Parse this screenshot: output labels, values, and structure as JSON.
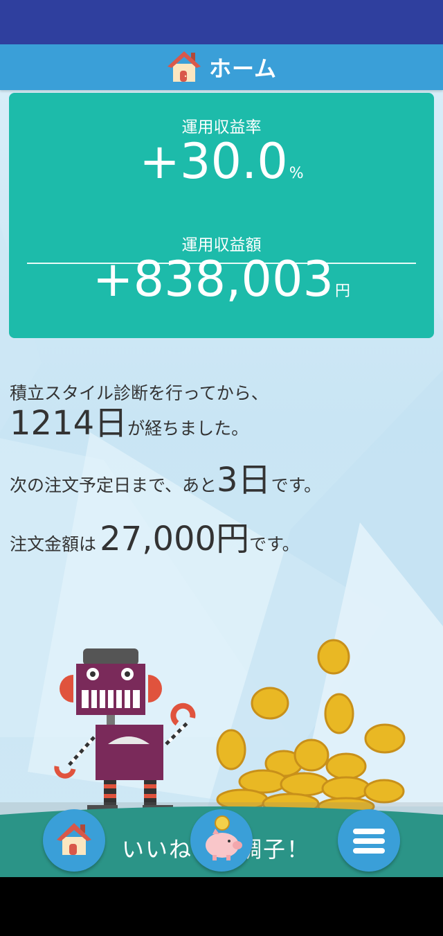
{
  "header": {
    "title": "ホーム",
    "icon": "house-icon"
  },
  "stats": {
    "rate_label": "運用収益率",
    "rate_value": "+30.0",
    "rate_unit": "%",
    "amount_label": "運用収益額",
    "amount_value": "+838,003",
    "amount_unit": "円"
  },
  "info": {
    "line1": "積立スタイル診断を行ってから、",
    "days_elapsed": "1214日",
    "days_elapsed_suffix": "が経ちました。",
    "next_order_prefix": "次の注文予定日まで、あと",
    "next_order_days": "3日",
    "next_order_suffix": "です。",
    "order_amount_prefix": "注文金額は",
    "order_amount": "27,000円",
    "order_amount_suffix": "です。"
  },
  "bottom": {
    "message": "いいね　の調子！",
    "home_icon": "house-icon",
    "piggy_icon": "piggy-bank-icon",
    "menu_icon": "hamburger-menu-icon"
  },
  "colors": {
    "status_bar": "#2f3f9e",
    "header": "#3a9fd8",
    "card": "#1dbbaa",
    "ground": "#1a9a8a"
  }
}
